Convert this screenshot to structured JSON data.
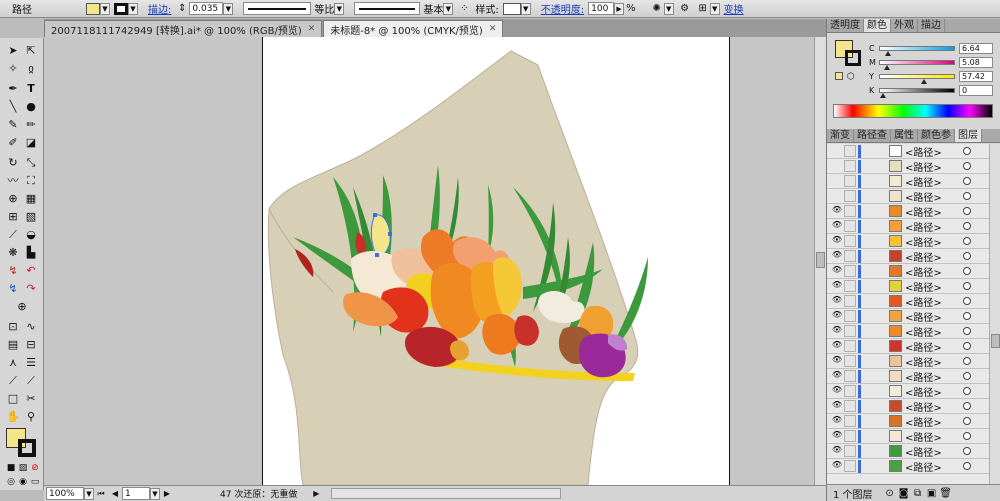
{
  "control": {
    "object_type": "路径",
    "stroke_label": "描边:",
    "stroke_weight": "0.035",
    "profile_label": "等比",
    "brush_label": "基本",
    "style_label": "样式:",
    "opacity_label": "不透明度:",
    "opacity_value": "100",
    "opacity_unit": "%",
    "transform_label": "变换",
    "fill_color": "#f3e68a"
  },
  "doc_tabs": [
    {
      "label": "2007118111742949 [转换].ai* @ 100% (RGB/预览)",
      "close": "✕"
    },
    {
      "label": "未标题-8* @ 100% (CMYK/预览)",
      "close": "✕"
    }
  ],
  "status": {
    "zoom": "100%",
    "artboard": "1",
    "undo": "47 次还原：无重做"
  },
  "color_panel": {
    "tabs": [
      "透明度",
      "颜色",
      "外观",
      "描边"
    ],
    "channels": [
      {
        "label": "C",
        "value": "6.64",
        "pos": 0.07
      },
      {
        "label": "M",
        "value": "5.08",
        "pos": 0.05
      },
      {
        "label": "Y",
        "value": "57.42",
        "pos": 0.57
      },
      {
        "label": "K",
        "value": "0",
        "pos": 0.0
      }
    ]
  },
  "layers_panel": {
    "tabs": [
      "渐变",
      "路径查",
      "属性",
      "颜色参",
      "图层"
    ],
    "footer": "1 个图层",
    "rows": [
      {
        "name": "<路径>",
        "thumb": "#ffffff",
        "eye": false
      },
      {
        "name": "<路径>",
        "thumb": "#e9dcc2",
        "eye": false
      },
      {
        "name": "<路径>",
        "thumb": "#f0ead6",
        "eye": false
      },
      {
        "name": "<路径>",
        "thumb": "#ede4cc",
        "eye": false
      },
      {
        "name": "<路径>",
        "thumb": "#e98a2a",
        "eye": true
      },
      {
        "name": "<路径>",
        "thumb": "#f2a03c",
        "eye": true
      },
      {
        "name": "<路径>",
        "thumb": "#f4c23a",
        "eye": true
      },
      {
        "name": "<路径>",
        "thumb": "#c8402a",
        "eye": true
      },
      {
        "name": "<路径>",
        "thumb": "#e07a2a",
        "eye": true
      },
      {
        "name": "<路径>",
        "thumb": "#e4d23c",
        "eye": true
      },
      {
        "name": "<路径>",
        "thumb": "#e25a20",
        "eye": true
      },
      {
        "name": "<路径>",
        "thumb": "#f0a440",
        "eye": true
      },
      {
        "name": "<路径>",
        "thumb": "#ec8a30",
        "eye": true
      },
      {
        "name": "<路径>",
        "thumb": "#d2332a",
        "eye": true
      },
      {
        "name": "<路径>",
        "thumb": "#e8c49a",
        "eye": true
      },
      {
        "name": "<路径>",
        "thumb": "#f0dcc2",
        "eye": true
      },
      {
        "name": "<路径>",
        "thumb": "#f0ecd8",
        "eye": true
      },
      {
        "name": "<路径>",
        "thumb": "#c84a2a",
        "eye": true
      },
      {
        "name": "<路径>",
        "thumb": "#d8742a",
        "eye": true
      },
      {
        "name": "<路径>",
        "thumb": "#f0e8d0",
        "eye": true
      },
      {
        "name": "<路径>",
        "thumb": "#3e9a3e",
        "eye": true
      },
      {
        "name": "<路径>",
        "thumb": "#4aa048",
        "eye": true
      }
    ]
  }
}
